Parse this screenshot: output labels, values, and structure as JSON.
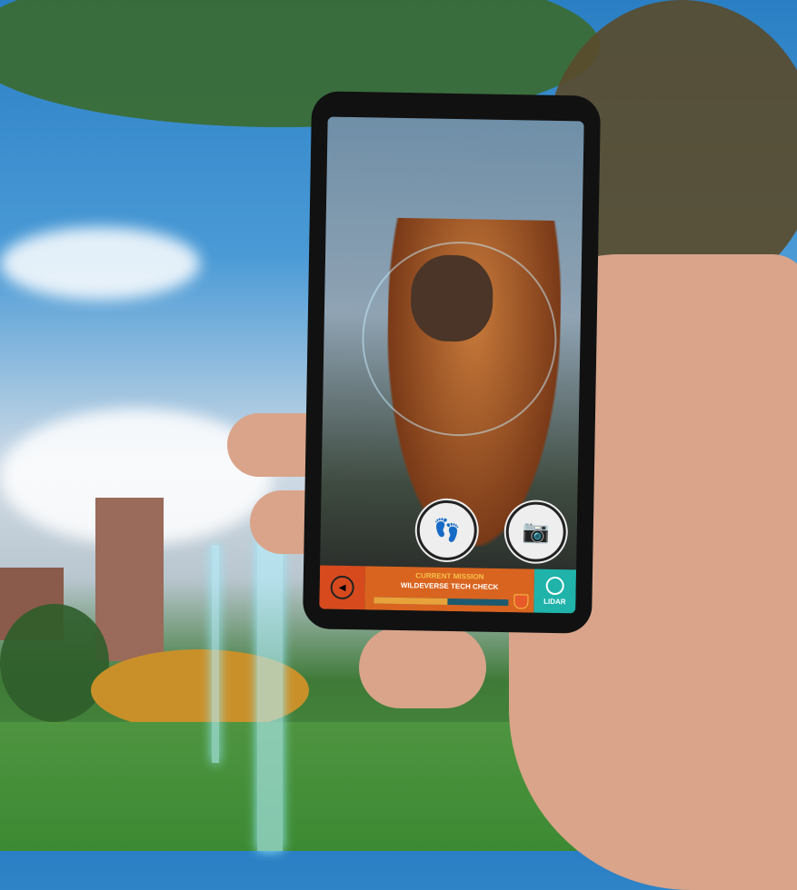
{
  "app": {
    "current_mission_label": "CURRENT MISSION",
    "mission_name": "WILDEVERSE TECH CHECK",
    "mission_progress_percent": 55,
    "lidar_label": "LIDAR",
    "icons": [
      "back-arrow-icon",
      "footprint-icon",
      "camera-icon",
      "lidar-icon",
      "shield-badge-icon"
    ],
    "colors": {
      "back": "#d64a1e",
      "mission": "#d9641f",
      "lidar": "#1fb3aa",
      "progress": "#e8a23a"
    }
  }
}
